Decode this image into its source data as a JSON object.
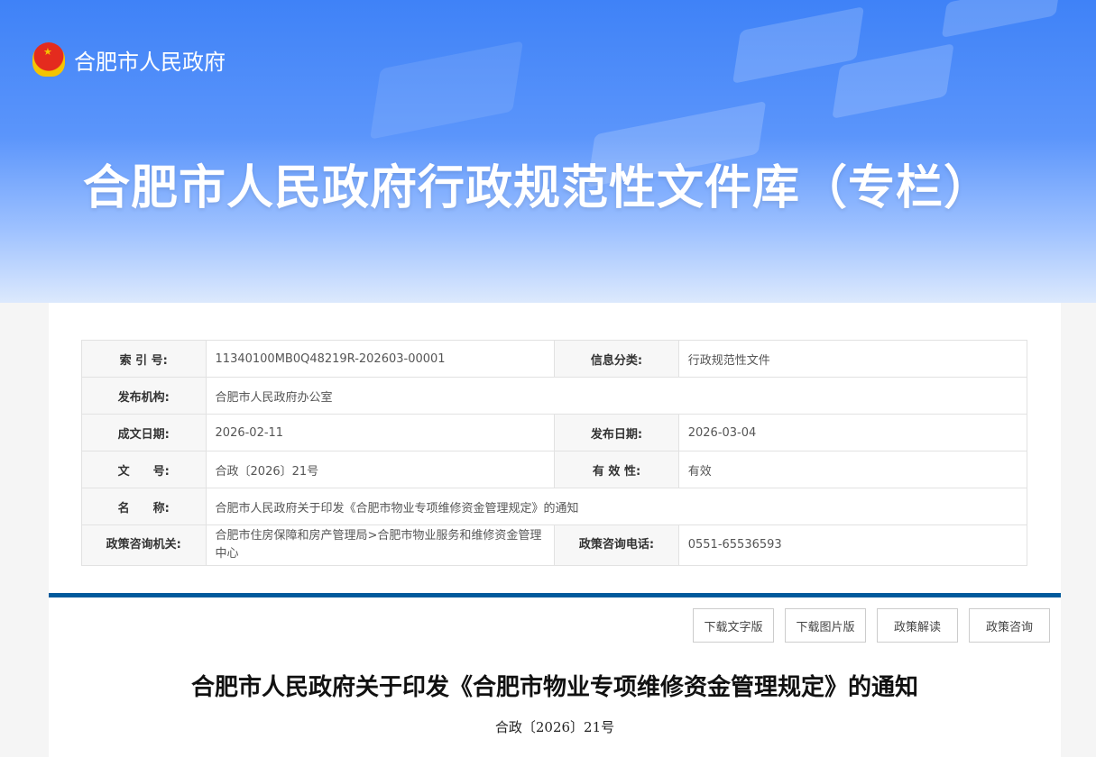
{
  "header": {
    "site_name": "合肥市人民政府",
    "banner_title": "合肥市人民政府行政规范性文件库（专栏）"
  },
  "info": {
    "index_label": "索 引 号:",
    "index_value": "11340100MB0Q48219R-202603-00001",
    "category_label": "信息分类:",
    "category_value": "行政规范性文件",
    "publisher_label": "发布机构:",
    "publisher_value": "合肥市人民政府办公室",
    "written_label": "成文日期:",
    "written_value": "2026-02-11",
    "published_label": "发布日期:",
    "published_value": "2026-03-04",
    "docno_label": "文　　号:",
    "docno_value": "合政〔2026〕21号",
    "validity_label": "有 效 性:",
    "validity_value": "有效",
    "name_label": "名　　称:",
    "name_value": "合肥市人民政府关于印发《合肥市物业专项维修资金管理规定》的通知",
    "consult_org_label": "政策咨询机关:",
    "consult_org_value": "合肥市住房保障和房产管理局>合肥市物业服务和维修资金管理中心",
    "consult_phone_label": "政策咨询电话:",
    "consult_phone_value": "0551-65536593"
  },
  "actions": {
    "download_text": "下载文字版",
    "download_image": "下载图片版",
    "interpretation": "政策解读",
    "consultation": "政策咨询"
  },
  "document": {
    "title": "合肥市人民政府关于印发《合肥市物业专项维修资金管理规定》的通知",
    "number": "合政〔2026〕21号"
  },
  "colors": {
    "accent": "#005a9c",
    "banner": "#4a8cff"
  }
}
